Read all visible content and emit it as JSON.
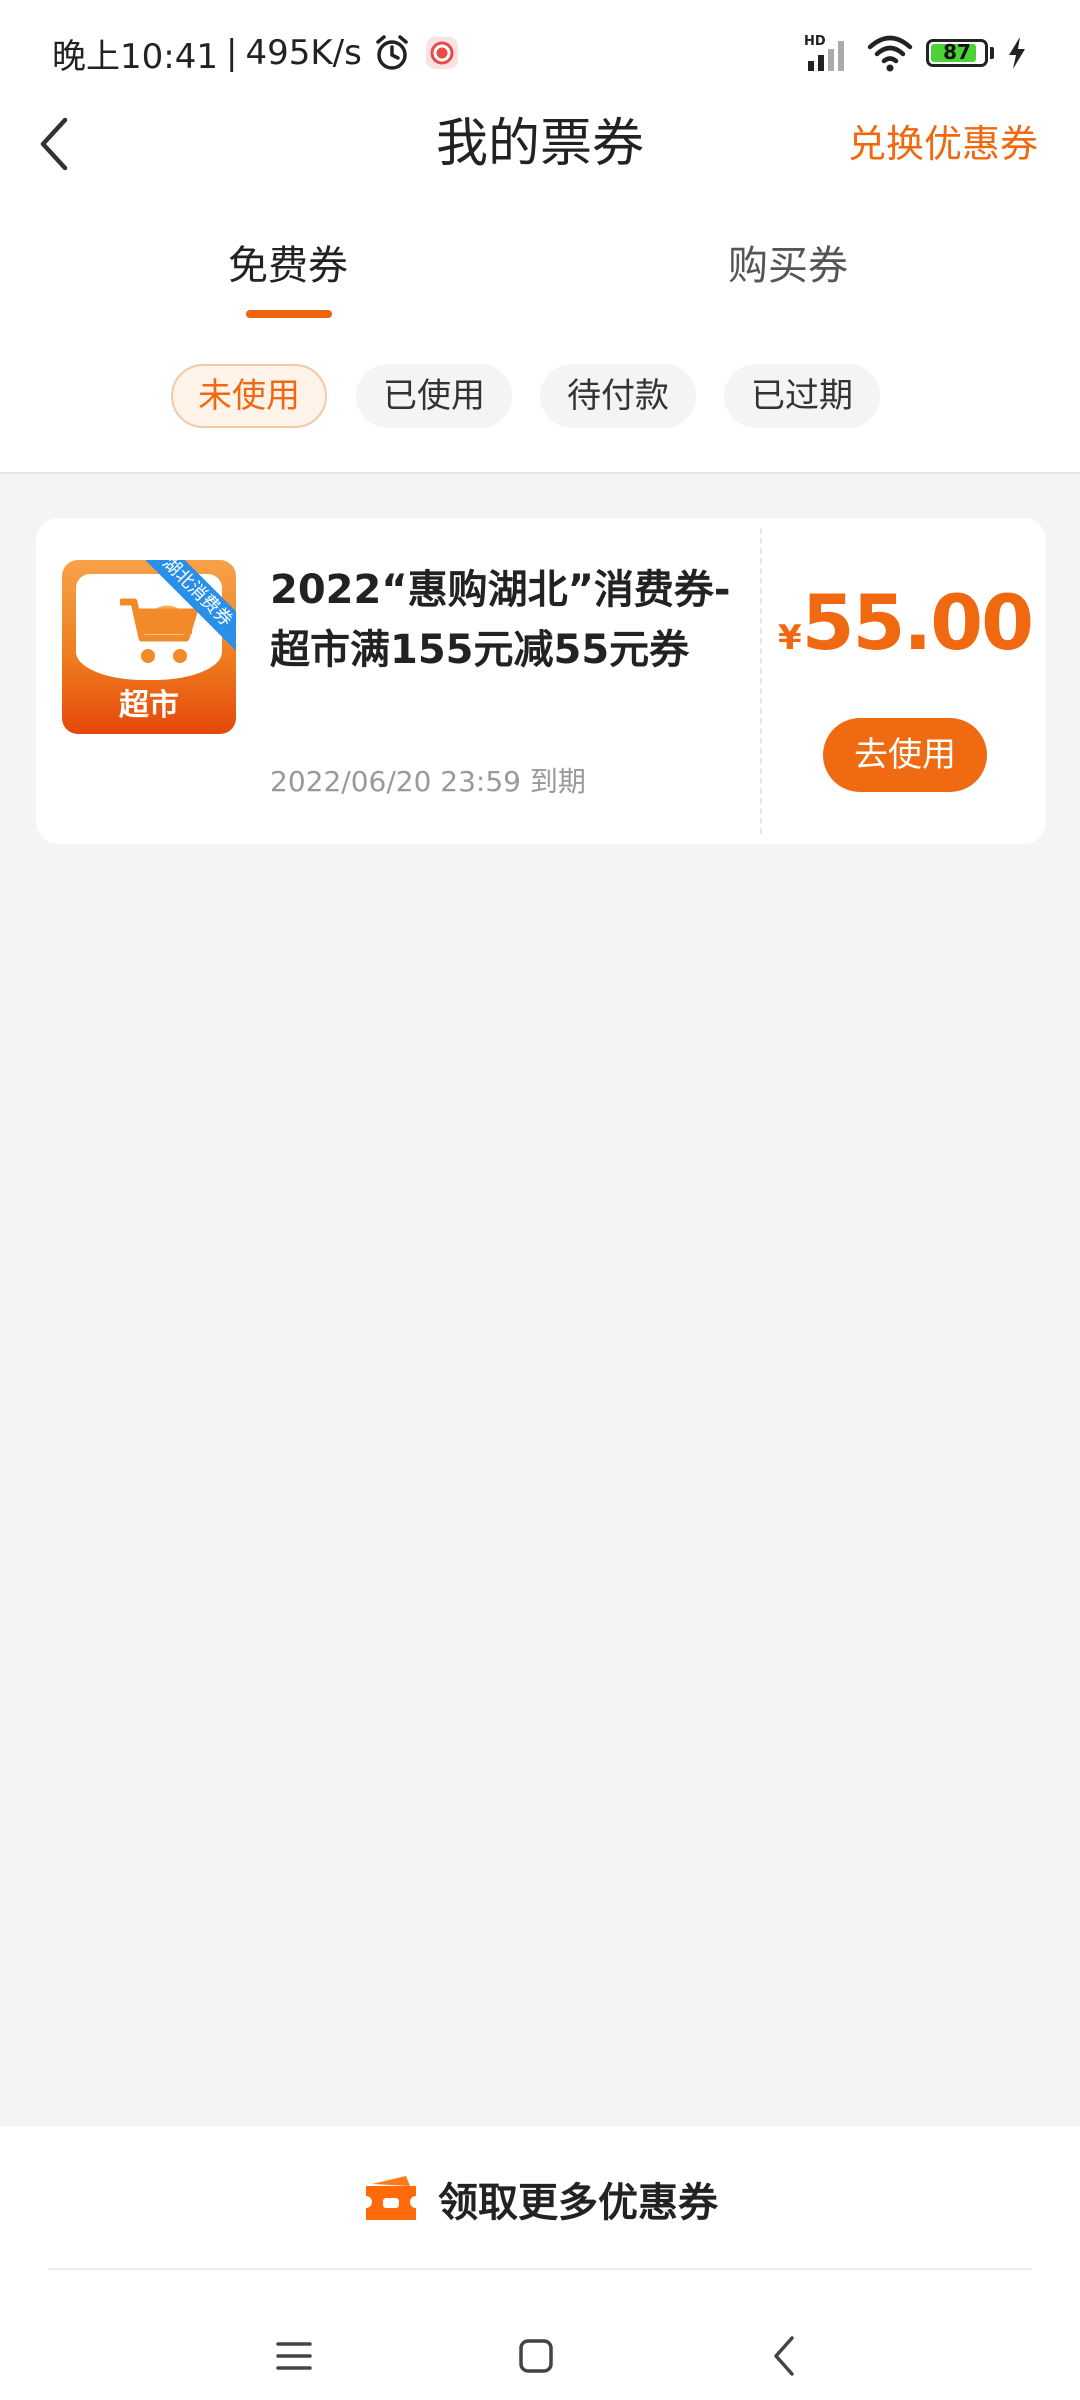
{
  "status_bar": {
    "time": "晚上10:41",
    "network_speed": "495K/s",
    "separator": "|",
    "battery": "87",
    "icons": [
      "alarm-icon",
      "record-icon",
      "hd-signal-icon",
      "wifi-icon",
      "battery-icon",
      "charging-icon"
    ]
  },
  "header": {
    "title": "我的票券",
    "action": "兑换优惠券"
  },
  "tabs": [
    {
      "label": "免费券",
      "active": true
    },
    {
      "label": "购买券",
      "active": false
    }
  ],
  "filters": [
    {
      "label": "未使用",
      "active": true
    },
    {
      "label": "已使用",
      "active": false
    },
    {
      "label": "待付款",
      "active": false
    },
    {
      "label": "已过期",
      "active": false
    }
  ],
  "coupon": {
    "logo_text": "超市",
    "ribbon": "湖北消费券",
    "title": "2022“惠购湖北”消费券-超市满155元减55元券",
    "expiry": "2022/06/20 23:59 到期",
    "currency": "¥",
    "amount": "55.00",
    "action": "去使用"
  },
  "footer": {
    "more": "领取更多优惠券"
  },
  "colors": {
    "accent": "#f0680f",
    "background": "#f4f4f4",
    "ribbon": "#2a8fe8"
  }
}
